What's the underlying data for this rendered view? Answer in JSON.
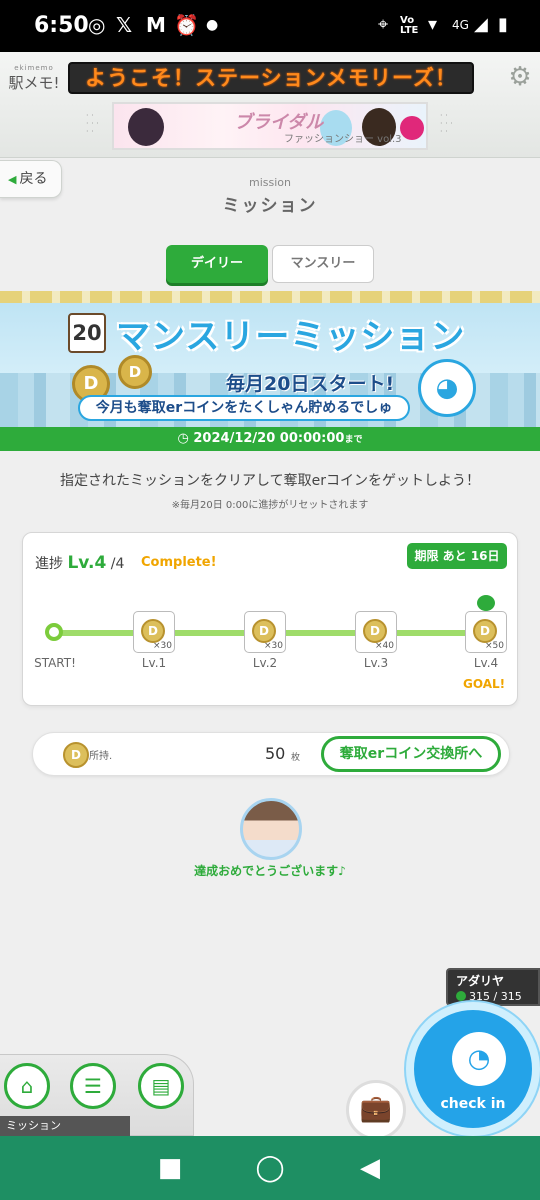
{
  "statusbar": {
    "time": "6:50",
    "network": "4G"
  },
  "header": {
    "logo": "駅メモ!",
    "logo_sub": "ekimemo",
    "marquee": "ようこそ！ステーションメモリーズ！",
    "ad": {
      "title": "ブライダル",
      "subtitle": "ファッションショー vol.3"
    }
  },
  "nav": {
    "back_label": "戻る"
  },
  "page": {
    "subtitle": "mission",
    "title": "ミッション"
  },
  "tabs": [
    {
      "label": "デイリー",
      "active": true
    },
    {
      "label": "マンスリー",
      "active": false
    }
  ],
  "banner": {
    "date_num": "20",
    "title": "マンスリーミッション",
    "start_text": "毎月20日スタート!",
    "catch": "今月も奪取erコインをたくしゃん貯めるでしゅ",
    "coin_glyph": "D"
  },
  "deadline": {
    "text": "2024/12/20 00:00:00",
    "suffix": "まで"
  },
  "description": "指定されたミッションをクリアして奪取erコインをゲットしよう！",
  "note": "※毎月20日 0:00に進捗がリセットされます",
  "progress": {
    "label": "進捗",
    "lv_prefix": "Lv.",
    "level": "4",
    "max": "/4",
    "status": "Complete!",
    "days_left": "期限 あと 16日",
    "start_label": "START!",
    "goal_label": "GOAL!",
    "levels": [
      {
        "label": "Lv.1",
        "reward": "×30"
      },
      {
        "label": "Lv.2",
        "reward": "×30"
      },
      {
        "label": "Lv.3",
        "reward": "×40"
      },
      {
        "label": "Lv.4",
        "reward": "×50"
      }
    ]
  },
  "wallet": {
    "label": "所持.",
    "count": "50",
    "unit": "枚",
    "exchange_label": "奪取erコイン交換所へ"
  },
  "congrats": "達成おめでとうございます♪",
  "station": {
    "name": "アダリヤ",
    "hp": "315 / 315"
  },
  "checkin": {
    "label": "check in"
  },
  "tray": {
    "label": "ミッション"
  },
  "colors": {
    "accent": "#2eab3b",
    "marquee": "#ff8a1c",
    "checkin": "#24a3e8",
    "navbar": "#1e8f63"
  }
}
